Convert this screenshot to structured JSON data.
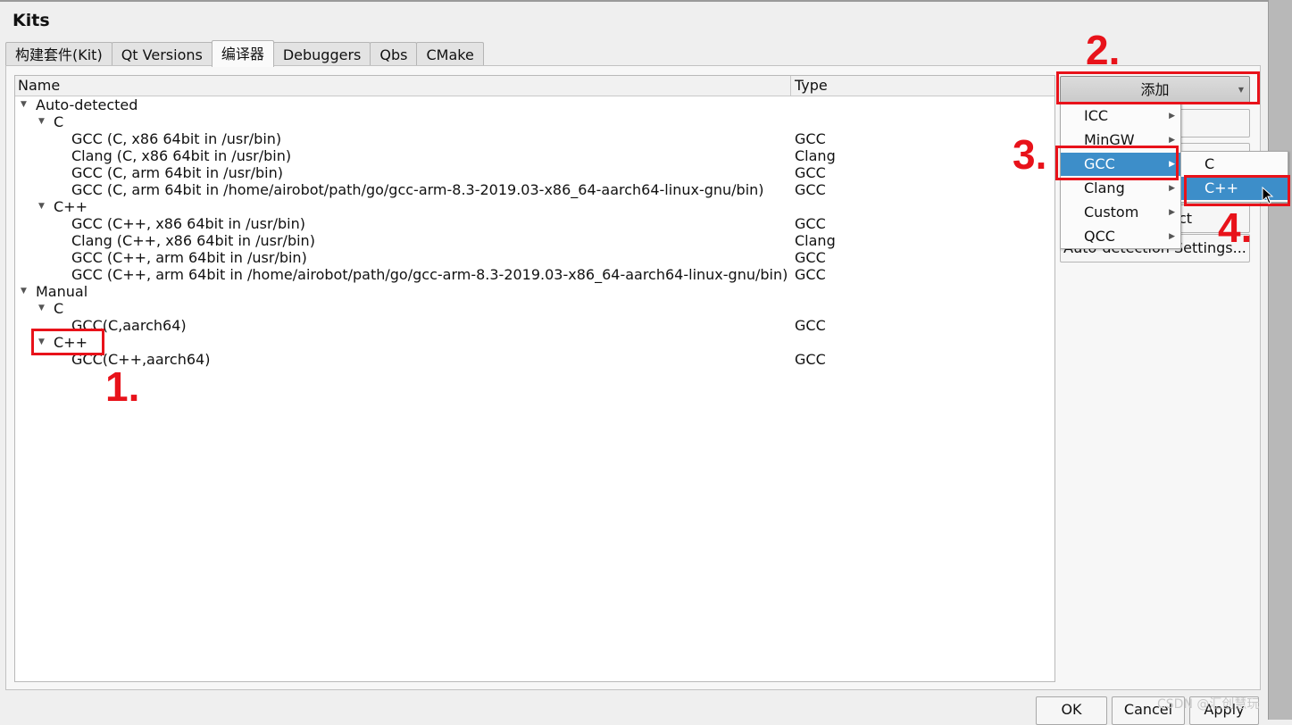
{
  "window": {
    "title": "Kits"
  },
  "tabs": [
    {
      "label": "构建套件(Kit)"
    },
    {
      "label": "Qt Versions"
    },
    {
      "label": "编译器"
    },
    {
      "label": "Debuggers"
    },
    {
      "label": "Qbs"
    },
    {
      "label": "CMake"
    }
  ],
  "tree": {
    "headers": {
      "name": "Name",
      "type": "Type"
    },
    "rows": [
      {
        "name": "Auto-detected",
        "type": ""
      },
      {
        "name": "C",
        "type": ""
      },
      {
        "name": "GCC (C, x86 64bit in /usr/bin)",
        "type": "GCC"
      },
      {
        "name": "Clang (C, x86 64bit in /usr/bin)",
        "type": "Clang"
      },
      {
        "name": "GCC (C, arm 64bit in /usr/bin)",
        "type": "GCC"
      },
      {
        "name": "GCC (C, arm 64bit in /home/airobot/path/go/gcc-arm-8.3-2019.03-x86_64-aarch64-linux-gnu/bin)",
        "type": "GCC"
      },
      {
        "name": "C++",
        "type": ""
      },
      {
        "name": "GCC (C++, x86 64bit in /usr/bin)",
        "type": "GCC"
      },
      {
        "name": "Clang (C++, x86 64bit in /usr/bin)",
        "type": "Clang"
      },
      {
        "name": "GCC (C++, arm 64bit in /usr/bin)",
        "type": "GCC"
      },
      {
        "name": "GCC (C++, arm 64bit in /home/airobot/path/go/gcc-arm-8.3-2019.03-x86_64-aarch64-linux-gnu/bin)",
        "type": "GCC"
      },
      {
        "name": "Manual",
        "type": ""
      },
      {
        "name": "C",
        "type": ""
      },
      {
        "name": "GCC(C,aarch64)",
        "type": "GCC"
      },
      {
        "name": "C++",
        "type": ""
      },
      {
        "name": "GCC(C++,aarch64)",
        "type": "GCC"
      }
    ]
  },
  "side_buttons": {
    "add": "添加",
    "remove_partial": "ct",
    "auto_detection_settings": "Auto-detection Settings..."
  },
  "add_menu": {
    "items": [
      {
        "label": "ICC"
      },
      {
        "label": "MinGW"
      },
      {
        "label": "GCC"
      },
      {
        "label": "Clang"
      },
      {
        "label": "Custom"
      },
      {
        "label": "QCC"
      }
    ]
  },
  "gcc_submenu": {
    "items": [
      {
        "label": "C"
      },
      {
        "label": "C++"
      }
    ]
  },
  "annotations": {
    "step1": "1.",
    "step2": "2.",
    "step3": "3.",
    "step4": "4.",
    "color": "#e8121a"
  },
  "dialog_buttons": {
    "ok": "OK",
    "cancel": "Cancel",
    "apply": "Apply"
  },
  "watermark": "CSDN @汇创慧玩"
}
